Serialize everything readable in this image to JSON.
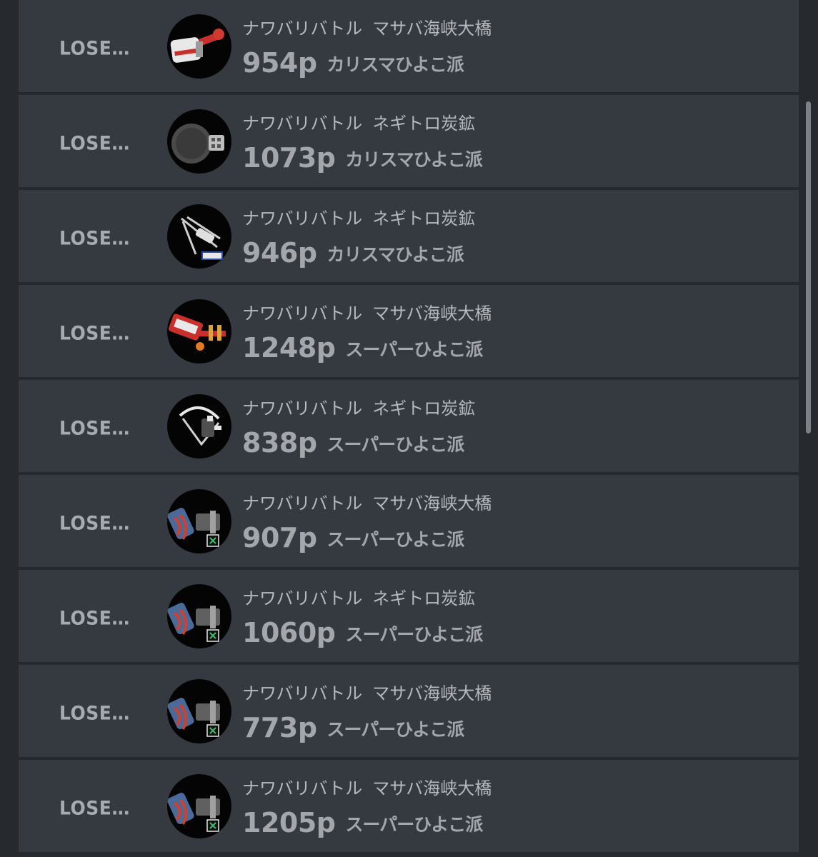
{
  "battles": [
    {
      "result": "LOSE…",
      "mode": "ナワバリバトル",
      "stage": "マサバ海峡大橋",
      "points": "954p",
      "rank": "カリスマひよこ派",
      "weapon_icon": "splat-roller-weapon-icon"
    },
    {
      "result": "LOSE…",
      "mode": "ナワバリバトル",
      "stage": "ネギトロ炭鉱",
      "points": "1073p",
      "rank": "カリスマひよこ派",
      "weapon_icon": "frying-pan-weapon-icon"
    },
    {
      "result": "LOSE…",
      "mode": "ナワバリバトル",
      "stage": "ネギトロ炭鉱",
      "points": "946p",
      "rank": "カリスマひよこ派",
      "weapon_icon": "stringer-weapon-icon"
    },
    {
      "result": "LOSE…",
      "mode": "ナワバリバトル",
      "stage": "マサバ海峡大橋",
      "points": "1248p",
      "rank": "スーパーひよこ派",
      "weapon_icon": "red-roller-weapon-icon"
    },
    {
      "result": "LOSE…",
      "mode": "ナワバリバトル",
      "stage": "ネギトロ炭鉱",
      "points": "838p",
      "rank": "スーパーひよこ派",
      "weapon_icon": "bow-weapon-icon"
    },
    {
      "result": "LOSE…",
      "mode": "ナワバリバトル",
      "stage": "マサバ海峡大橋",
      "points": "907p",
      "rank": "スーパーひよこ派",
      "weapon_icon": "collab-weapon-icon"
    },
    {
      "result": "LOSE…",
      "mode": "ナワバリバトル",
      "stage": "ネギトロ炭鉱",
      "points": "1060p",
      "rank": "スーパーひよこ派",
      "weapon_icon": "collab-weapon-icon"
    },
    {
      "result": "LOSE…",
      "mode": "ナワバリバトル",
      "stage": "マサバ海峡大橋",
      "points": "773p",
      "rank": "スーパーひよこ派",
      "weapon_icon": "collab-weapon-icon"
    },
    {
      "result": "LOSE…",
      "mode": "ナワバリバトル",
      "stage": "マサバ海峡大橋",
      "points": "1205p",
      "rank": "スーパーひよこ派",
      "weapon_icon": "collab-weapon-icon"
    }
  ]
}
